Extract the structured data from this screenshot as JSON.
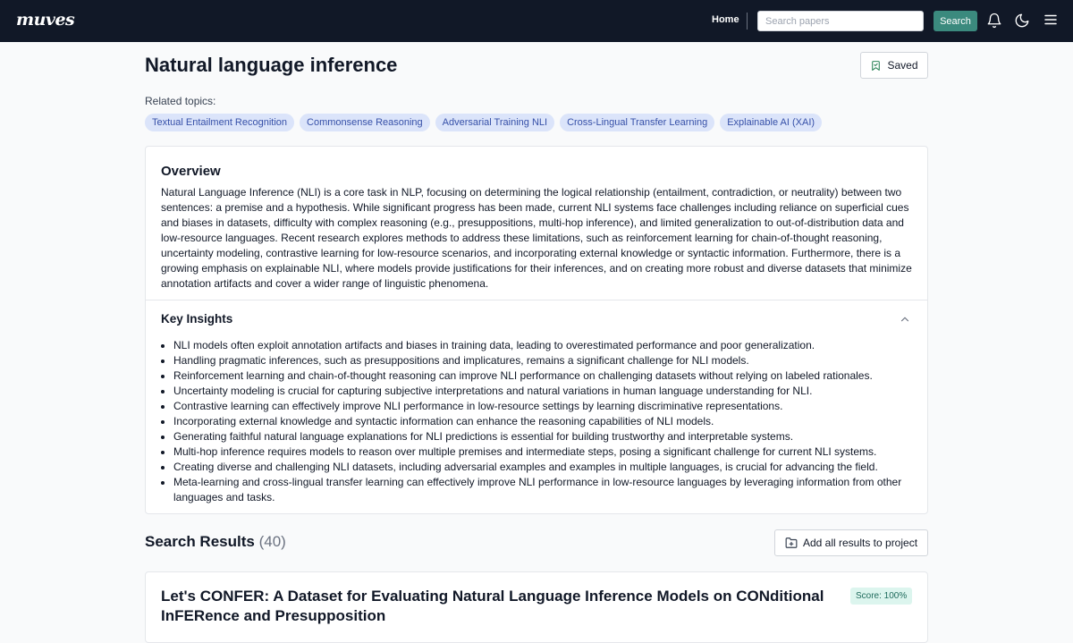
{
  "navbar": {
    "logo": "muves",
    "home_label": "Home",
    "search_placeholder": "Search papers",
    "search_button": "Search",
    "icons": [
      "bell-icon",
      "moon-icon",
      "menu-icon"
    ]
  },
  "topic": {
    "title": "Natural language inference",
    "saved_label": "Saved",
    "related_label": "Related topics:",
    "related_topics": [
      "Textual Entailment Recognition",
      "Commonsense Reasoning",
      "Adversarial Training NLI",
      "Cross-Lingual Transfer Learning",
      "Explainable AI (XAI)"
    ]
  },
  "overview": {
    "title": "Overview",
    "text": "Natural Language Inference (NLI) is a core task in NLP, focusing on determining the logical relationship (entailment, contradiction, or neutrality) between two sentences: a premise and a hypothesis. While significant progress has been made, current NLI systems face challenges including reliance on superficial cues and biases in datasets, difficulty with complex reasoning (e.g., presuppositions, multi-hop inference), and limited generalization to out-of-distribution data and low-resource languages. Recent research explores methods to address these limitations, such as reinforcement learning for chain-of-thought reasoning, uncertainty modeling, contrastive learning for low-resource scenarios, and incorporating external knowledge or syntactic information. Furthermore, there is a growing emphasis on explainable NLI, where models provide justifications for their inferences, and on creating more robust and diverse datasets that minimize annotation artifacts and cover a wider range of linguistic phenomena."
  },
  "insights": {
    "title": "Key Insights",
    "items": [
      "NLI models often exploit annotation artifacts and biases in training data, leading to overestimated performance and poor generalization.",
      "Handling pragmatic inferences, such as presuppositions and implicatures, remains a significant challenge for NLI models.",
      "Reinforcement learning and chain-of-thought reasoning can improve NLI performance on challenging datasets without relying on labeled rationales.",
      "Uncertainty modeling is crucial for capturing subjective interpretations and natural variations in human language understanding for NLI.",
      "Contrastive learning can effectively improve NLI performance in low-resource settings by learning discriminative representations.",
      "Incorporating external knowledge and syntactic information can enhance the reasoning capabilities of NLI models.",
      "Generating faithful natural language explanations for NLI predictions is essential for building trustworthy and interpretable systems.",
      "Multi-hop inference requires models to reason over multiple premises and intermediate steps, posing a significant challenge for current NLI systems.",
      "Creating diverse and challenging NLI datasets, including adversarial examples and examples in multiple languages, is crucial for advancing the field.",
      "Meta-learning and cross-lingual transfer learning can effectively improve NLI performance in low-resource languages by leveraging information from other languages and tasks."
    ]
  },
  "results": {
    "title": "Search Results",
    "count": "(40)",
    "add_all_label": "Add all results to project",
    "items": [
      {
        "title": "Let's CONFER: A Dataset for Evaluating Natural Language Inference Models on CONditional InFERence and Presupposition",
        "score": "Score: 100%"
      }
    ]
  },
  "colors": {
    "navbar_bg": "#111827",
    "accent": "#3b8a7e",
    "chip_bg": "#dbe4fa",
    "chip_text": "#3650a8",
    "score_bg": "#dcf5ee"
  }
}
